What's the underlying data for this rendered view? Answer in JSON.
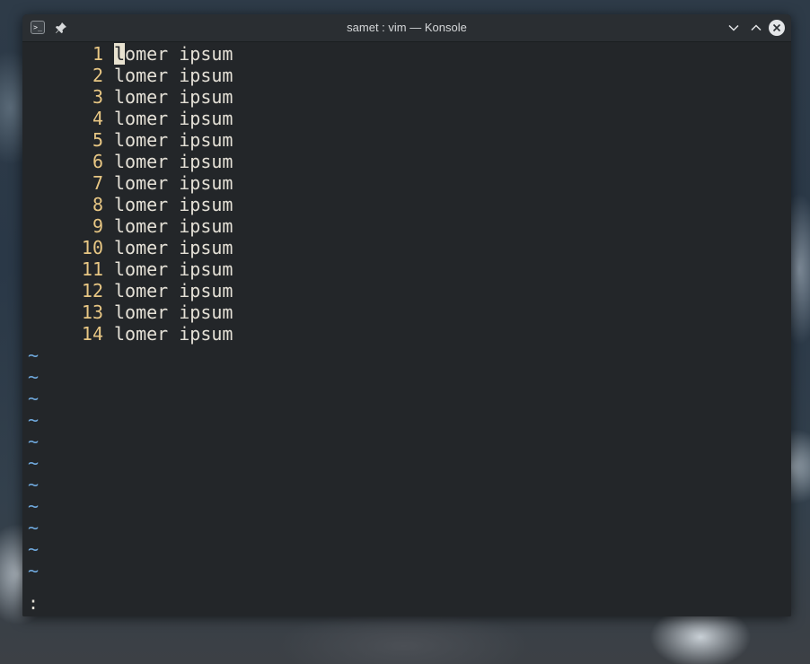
{
  "window": {
    "title": "samet : vim — Konsole",
    "app_icon_glyph": ">_"
  },
  "icons": {
    "app": "terminal-icon",
    "pin": "pin-icon",
    "minimize": "chevron-down-icon",
    "maximize": "chevron-up-icon",
    "close": "close-icon"
  },
  "editor": {
    "lines": [
      {
        "num": "1",
        "text": "lomer ipsum"
      },
      {
        "num": "2",
        "text": "lomer ipsum"
      },
      {
        "num": "3",
        "text": "lomer ipsum"
      },
      {
        "num": "4",
        "text": "lomer ipsum"
      },
      {
        "num": "5",
        "text": "lomer ipsum"
      },
      {
        "num": "6",
        "text": "lomer ipsum"
      },
      {
        "num": "7",
        "text": "lomer ipsum"
      },
      {
        "num": "8",
        "text": "lomer ipsum"
      },
      {
        "num": "9",
        "text": "lomer ipsum"
      },
      {
        "num": "10",
        "text": "lomer ipsum"
      },
      {
        "num": "11",
        "text": "lomer ipsum"
      },
      {
        "num": "12",
        "text": "lomer ipsum"
      },
      {
        "num": "13",
        "text": "lomer ipsum"
      },
      {
        "num": "14",
        "text": "lomer ipsum"
      }
    ],
    "empty_marker": "~",
    "empty_line_count": 11,
    "command_line": ":"
  },
  "colors": {
    "background": "#232629",
    "line_number": "#e8c784",
    "text": "#e4e0d6",
    "tilde": "#6fa8dc"
  }
}
